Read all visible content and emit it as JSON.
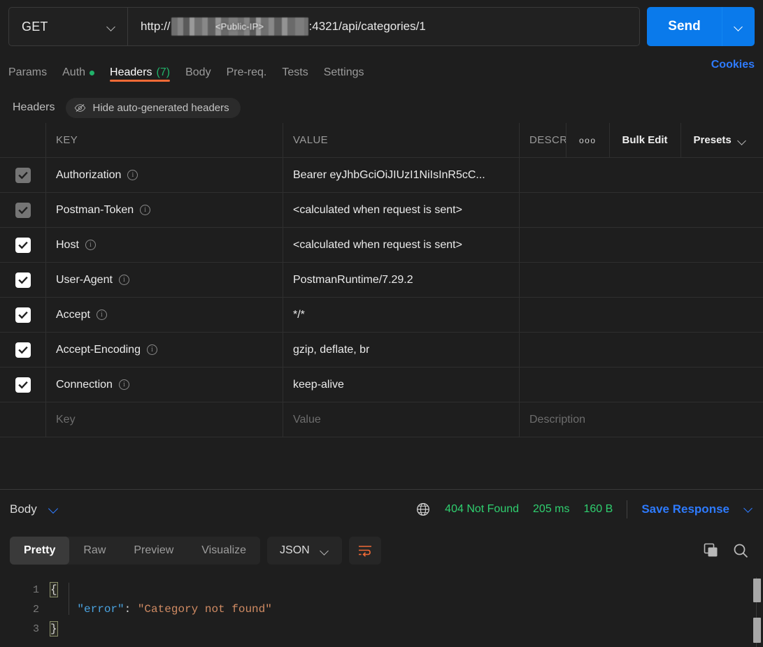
{
  "request": {
    "method": "GET",
    "url_prefix": "http://",
    "url_mask_label": "<Public-IP>",
    "url_suffix": ":4321/api/categories/1",
    "send_label": "Send"
  },
  "tabs": [
    {
      "label": "Params",
      "active": false,
      "dot": false,
      "count": ""
    },
    {
      "label": "Auth",
      "active": false,
      "dot": true,
      "count": ""
    },
    {
      "label": "Headers",
      "active": true,
      "dot": false,
      "count": "(7)"
    },
    {
      "label": "Body",
      "active": false,
      "dot": false,
      "count": ""
    },
    {
      "label": "Pre-req.",
      "active": false,
      "dot": false,
      "count": ""
    },
    {
      "label": "Tests",
      "active": false,
      "dot": false,
      "count": ""
    },
    {
      "label": "Settings",
      "active": false,
      "dot": false,
      "count": ""
    }
  ],
  "cookies_label": "Cookies",
  "subheader": {
    "title": "Headers",
    "hide_autogen_label": "Hide auto-generated headers"
  },
  "table": {
    "columns": {
      "key": "KEY",
      "value": "VALUE",
      "desc": "DESCRIPTION"
    },
    "tools": {
      "more": "ooo",
      "bulk_edit": "Bulk Edit",
      "presets": "Presets"
    },
    "rows": [
      {
        "checked": true,
        "dim": true,
        "key": "Authorization",
        "value": "Bearer eyJhbGciOiJIUzI1NiIsInR5cC...",
        "desc": ""
      },
      {
        "checked": true,
        "dim": true,
        "key": "Postman-Token",
        "value": "<calculated when request is sent>",
        "desc": ""
      },
      {
        "checked": true,
        "dim": false,
        "key": "Host",
        "value": "<calculated when request is sent>",
        "desc": ""
      },
      {
        "checked": true,
        "dim": false,
        "key": "User-Agent",
        "value": "PostmanRuntime/7.29.2",
        "desc": ""
      },
      {
        "checked": true,
        "dim": false,
        "key": "Accept",
        "value": "*/*",
        "desc": ""
      },
      {
        "checked": true,
        "dim": false,
        "key": "Accept-Encoding",
        "value": "gzip, deflate, br",
        "desc": ""
      },
      {
        "checked": true,
        "dim": false,
        "key": "Connection",
        "value": "keep-alive",
        "desc": ""
      }
    ],
    "placeholder_row": {
      "key": "Key",
      "value": "Value",
      "desc": "Description"
    }
  },
  "response": {
    "body_label": "Body",
    "status": "404 Not Found",
    "time": "205 ms",
    "size": "160 B",
    "save_label": "Save Response",
    "view_tabs": [
      {
        "label": "Pretty",
        "active": true
      },
      {
        "label": "Raw",
        "active": false
      },
      {
        "label": "Preview",
        "active": false
      },
      {
        "label": "Visualize",
        "active": false
      }
    ],
    "format": "JSON",
    "code_lines": [
      {
        "n": "1",
        "parts": [
          {
            "t": "{",
            "c": "brace"
          }
        ]
      },
      {
        "n": "2",
        "parts": [
          {
            "t": "    ",
            "c": "punct"
          },
          {
            "t": "\"error\"",
            "c": "key"
          },
          {
            "t": ": ",
            "c": "punct"
          },
          {
            "t": "\"Category not found\"",
            "c": "str"
          }
        ]
      },
      {
        "n": "3",
        "parts": [
          {
            "t": "}",
            "c": "brace"
          }
        ]
      }
    ]
  },
  "colors": {
    "accent_blue": "#0a7aeb",
    "link_blue": "#2e7bff",
    "active_orange": "#f06a36",
    "status_green": "#2fcf6f",
    "dot_green": "#21b26a",
    "bg": "#1e1e1e",
    "panel": "#212121"
  }
}
